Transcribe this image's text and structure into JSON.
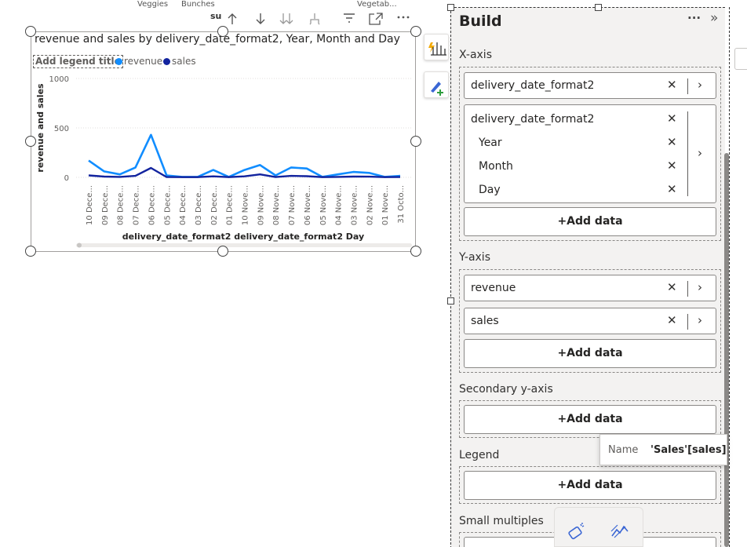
{
  "toolbar": {
    "tab_veggies": "Veggies",
    "tab_bunches": "Bunches",
    "tab_vegetab": "Vegetab...",
    "tab_su": "su",
    "icons": [
      "arrow-up-icon",
      "arrow-down-icon",
      "double-arrow-down-icon",
      "expand-hierarchy-icon",
      "filter-icon",
      "focus-mode-icon",
      "more-options-icon"
    ]
  },
  "chart_data": {
    "type": "line",
    "title": "revenue and sales by delivery_date_format2, Year, Month and Day",
    "legend_title": "Add legend title",
    "xlabel": "delivery_date_format2 delivery_date_format2 Day",
    "ylabel": "revenue and sales",
    "ylim": [
      0,
      1000
    ],
    "yticks": [
      "1000",
      "500",
      "0"
    ],
    "categories": [
      "10 Dece...",
      "09 Dece...",
      "08 Dece...",
      "07 Dece...",
      "06 Dece...",
      "05 Dece...",
      "04 Dece...",
      "03 Dece...",
      "02 Dece...",
      "01 Dece...",
      "10 Nove...",
      "09 Nove...",
      "08 Nove...",
      "07 Nove...",
      "06 Nove...",
      "05 Nove...",
      "04 Nove...",
      "03 Nove...",
      "02 Nove...",
      "01 Nove...",
      "31 Octo..."
    ],
    "series": [
      {
        "name": "revenue",
        "color": "#118DFF",
        "values": [
          170,
          60,
          30,
          100,
          430,
          20,
          5,
          5,
          75,
          5,
          75,
          125,
          20,
          100,
          90,
          5,
          30,
          55,
          45,
          5,
          15
        ]
      },
      {
        "name": "sales",
        "color": "#12239E",
        "values": [
          20,
          8,
          5,
          15,
          95,
          3,
          2,
          2,
          10,
          2,
          10,
          30,
          3,
          15,
          12,
          2,
          5,
          8,
          7,
          2,
          3
        ]
      }
    ],
    "grid": true,
    "legend_position": "top-left"
  },
  "side_tools": {
    "format_icon": "lightning-chart-icon",
    "paint_icon": "paintbrush-add-icon"
  },
  "pane": {
    "title": "Build",
    "more_label": "···",
    "collapse_label": "»",
    "x_axis": {
      "label": "X-axis",
      "field1": "delivery_date_format2",
      "hierarchy": {
        "name": "delivery_date_format2",
        "levels": [
          "Year",
          "Month",
          "Day"
        ]
      },
      "add": "+Add data"
    },
    "y_axis": {
      "label": "Y-axis",
      "fields": [
        "revenue",
        "sales"
      ],
      "add": "+Add data"
    },
    "secondary_y": {
      "label": "Secondary y-axis",
      "add": "+Add data"
    },
    "legend": {
      "label": "Legend",
      "add": "+Add data"
    },
    "small_multiples": {
      "label": "Small multiples"
    }
  },
  "tooltip": {
    "key": "Name",
    "value": "'Sales'[sales]"
  },
  "bottom_tools": [
    "build-visual-icon",
    "format-visual-icon"
  ]
}
